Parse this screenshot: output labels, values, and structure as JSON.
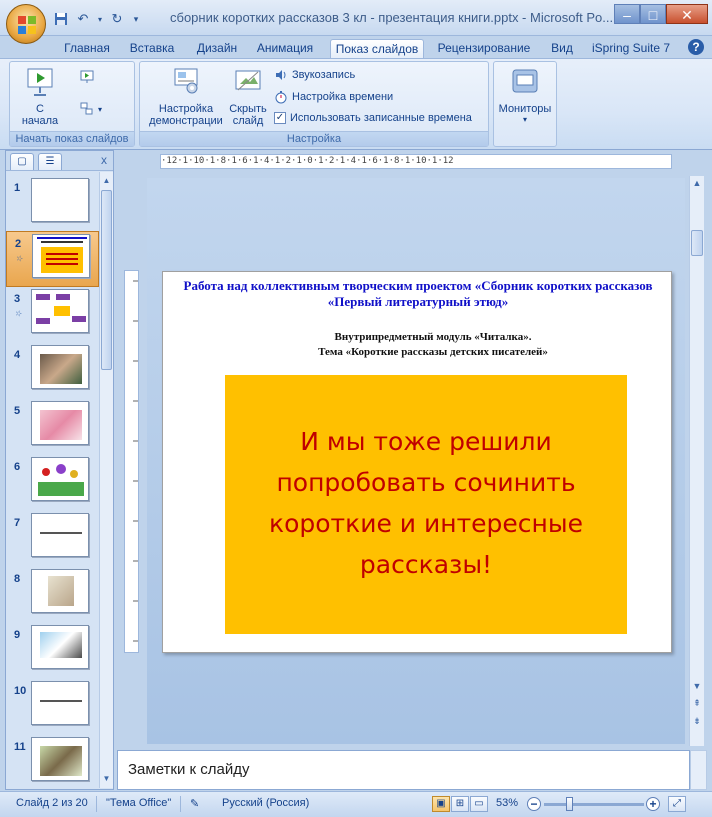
{
  "window": {
    "title": "сборник коротких рассказов 3 кл - презентация книги.pptx - Microsoft Po...",
    "minimize": "–",
    "maximize": "□",
    "close": "✕"
  },
  "tabs": [
    {
      "label": "Главная",
      "active": false
    },
    {
      "label": "Вставка",
      "active": false
    },
    {
      "label": "Дизайн",
      "active": false
    },
    {
      "label": "Анимация",
      "active": false
    },
    {
      "label": "Показ слайдов",
      "active": true
    },
    {
      "label": "Рецензирование",
      "active": false
    },
    {
      "label": "Вид",
      "active": false
    },
    {
      "label": "iSpring Suite 7",
      "active": false
    }
  ],
  "ribbon": {
    "start_group": {
      "label": "Начать показ слайдов",
      "from_start_l1": "С",
      "from_start_l2": "начала"
    },
    "setup_group": {
      "label": "Настройка",
      "setup_show_l1": "Настройка",
      "setup_show_l2": "демонстрации",
      "hide_slide_l1": "Скрыть",
      "hide_slide_l2": "слайд",
      "record_narration": "Звукозапись",
      "rehearse_timings": "Настройка времени",
      "use_timings": "Использовать записанные времена",
      "use_timings_checked": true
    },
    "monitors_group": {
      "label": "Мониторы"
    }
  },
  "slides_panel": {
    "count": 11,
    "selected": 2,
    "numbers": [
      "1",
      "2",
      "3",
      "4",
      "5",
      "6",
      "7",
      "8",
      "9",
      "10",
      "11"
    ]
  },
  "slide": {
    "title": "Работа над коллективным творческим проектом «Сборник коротких рассказов «Первый  литературный этюд»",
    "subtitle_l1": "Внутрипредметный модуль «Читалка».",
    "subtitle_l2": "Тема  «Короткие рассказы детских писателей»",
    "box_text_l1": "И мы тоже решили",
    "box_text_l2": "попробовать сочинить",
    "box_text_l3": "короткие и интересные",
    "box_text_l4": "рассказы!",
    "box_color": "#ffc000",
    "text_color": "#c00000"
  },
  "ruler": {
    "horizontal": "·12·1·10·1·8·1·6·1·4·1·2·1·0·1·2·1·4·1·6·1·8·1·10·1·12"
  },
  "notes": {
    "placeholder": "Заметки к слайду"
  },
  "status": {
    "slide_info": "Слайд 2 из 20",
    "theme": "\"Тема Office\"",
    "language": "Русский (Россия)",
    "zoom": "53%"
  }
}
